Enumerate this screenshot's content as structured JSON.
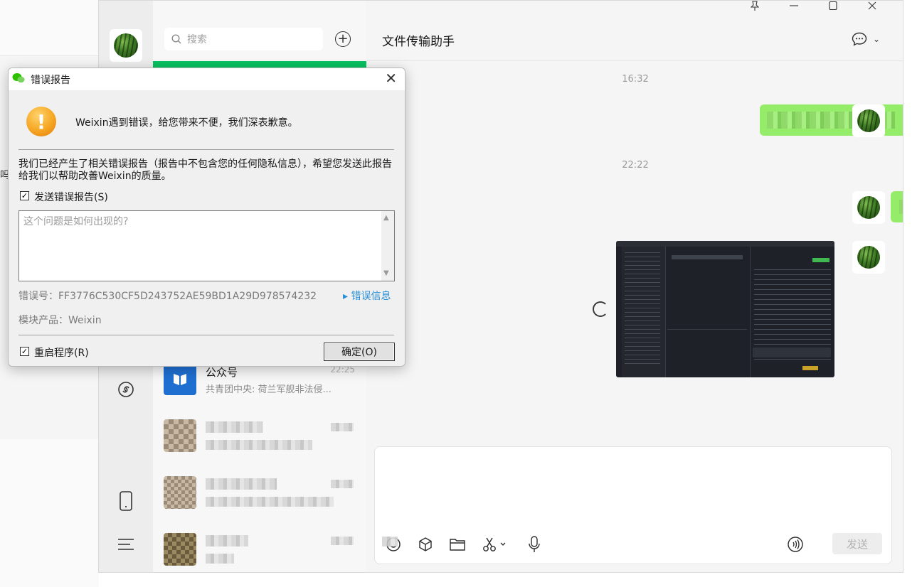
{
  "background": {
    "fragment_text": "吗"
  },
  "search": {
    "placeholder": "搜索"
  },
  "chat_list": [
    {
      "name": "公众号",
      "time": "22:25",
      "preview": "共青团中央: 荷兰军舰非法侵..."
    }
  ],
  "chat": {
    "title": "文件传输助手",
    "messages": [
      {
        "time": "16:32",
        "text_visible": "52"
      },
      {
        "time": "22:22"
      }
    ],
    "send_label": "发送"
  },
  "dialog": {
    "title": "错误报告",
    "headline": "Weixin遇到错误，给您带来不便，我们深表歉意。",
    "body": "我们已经产生了相关错误报告（报告中不包含您的任何隐私信息），希望您发送此报告给我们以帮助改善Weixin的质量。",
    "send_report_label": "发送错误报告(S)",
    "textarea_placeholder": "这个问题是如何出现的?",
    "error_number": "错误号：FF3776C530CF5D243752AE59BD1A29D978574232",
    "error_info_link": "▸ 错误信息",
    "module": "模块产品：Weixin",
    "restart_label": "重启程序(R)",
    "ok_label": "确定(O)",
    "send_report_checked": true,
    "restart_checked": true
  },
  "colors": {
    "accent_green": "#07c160",
    "bubble_green": "#95ec69",
    "warning_orange": "#f5a623",
    "link_blue": "#2a8fd6"
  }
}
